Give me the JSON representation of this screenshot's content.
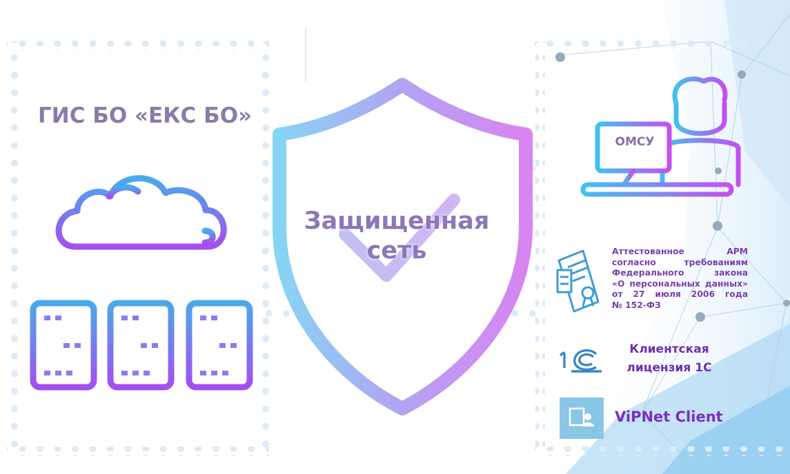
{
  "left": {
    "title": "ГИС БО «ЕКС БО»"
  },
  "center": {
    "shield_text": [
      "Защищенная",
      "сеть"
    ]
  },
  "right": {
    "workstation_label": "ОМСУ",
    "certification_lines": [
      "Аттестованное АРМ",
      "согласно требованиям",
      "Федерального закона",
      "«О персональных данных»",
      "от 27 июля 2006 года",
      "№ 152-ФЗ"
    ],
    "license_lines": [
      "Клиентская",
      "лицензия 1С"
    ],
    "vipnet_label": "ViPNet Client"
  },
  "icons": [
    "cloud-servers-icon",
    "shield-check-icon",
    "operator-workstation-icon",
    "certificate-icon",
    "1c-logo-icon",
    "vipnet-icon"
  ],
  "colors": {
    "gradient_blue": "#4fb6ee",
    "gradient_purple": "#b24ef0",
    "text_purple": "#7a3fb0",
    "title_gray": "#8a7ba8",
    "dot_blue": "#dcebf8"
  }
}
